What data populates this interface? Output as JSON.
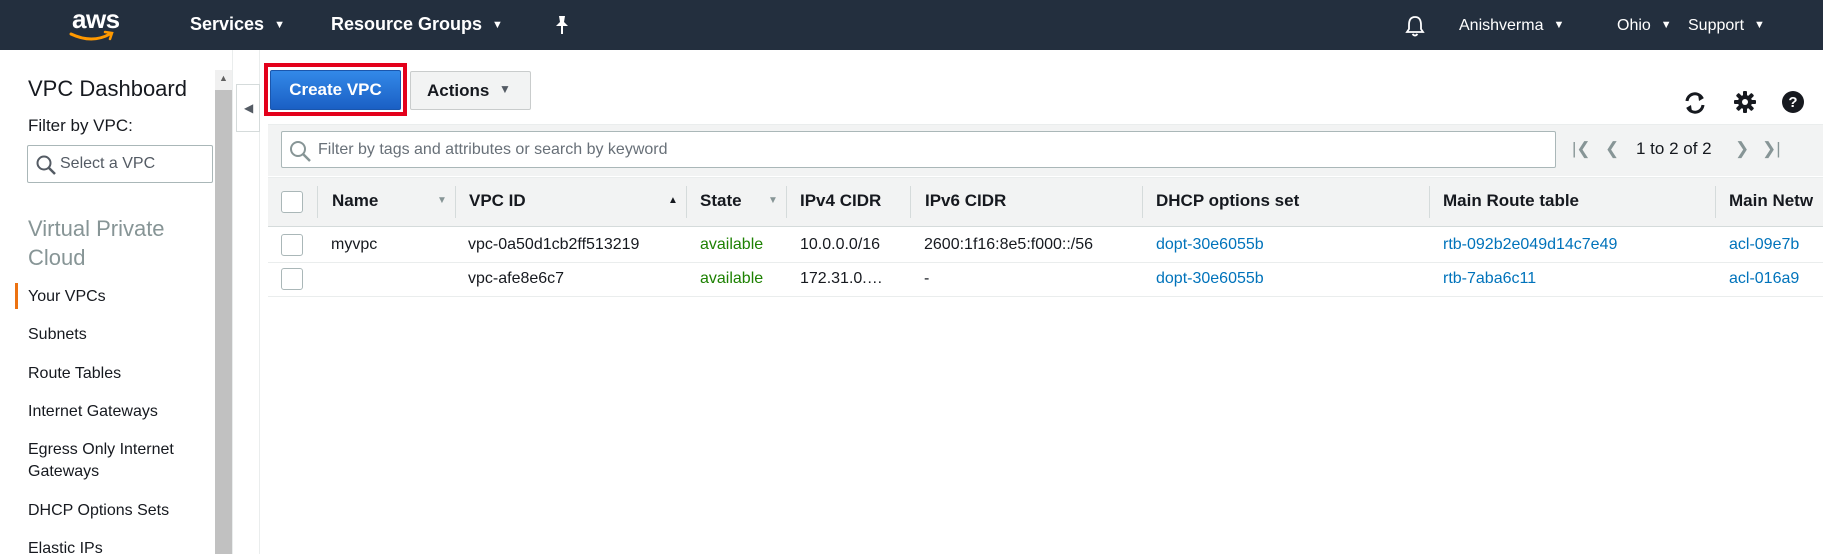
{
  "topnav": {
    "logo_text": "aws",
    "services": "Services",
    "resource_groups": "Resource Groups",
    "user": "Anishverma",
    "region": "Ohio",
    "support": "Support"
  },
  "sidebar": {
    "title": "VPC Dashboard",
    "filter_label": "Filter by VPC:",
    "select_placeholder": "Select a VPC",
    "section": "Virtual Private Cloud",
    "items": [
      {
        "label": "Your VPCs",
        "active": true
      },
      {
        "label": "Subnets"
      },
      {
        "label": "Route Tables"
      },
      {
        "label": "Internet Gateways"
      },
      {
        "label": "Egress Only Internet Gateways"
      },
      {
        "label": "DHCP Options Sets"
      },
      {
        "label": "Elastic IPs"
      }
    ]
  },
  "toolbar": {
    "create_label": "Create VPC",
    "actions_label": "Actions"
  },
  "filter": {
    "placeholder": "Filter by tags and attributes or search by keyword",
    "pager_text": "1 to 2 of 2"
  },
  "table": {
    "headers": [
      "Name",
      "VPC ID",
      "State",
      "IPv4 CIDR",
      "IPv6 CIDR",
      "DHCP options set",
      "Main Route table",
      "Main Netw"
    ],
    "rows": [
      {
        "name": "myvpc",
        "vpc_id": "vpc-0a50d1cb2ff513219",
        "state": "available",
        "ipv4": "10.0.0.0/16",
        "ipv6": "2600:1f16:8e5:f000::/56",
        "dhcp": "dopt-30e6055b",
        "route": "rtb-092b2e049d14c7e49",
        "acl": "acl-09e7b"
      },
      {
        "name": "",
        "vpc_id": "vpc-afe8e6c7",
        "state": "available",
        "ipv4": "172.31.0.…",
        "ipv6": "-",
        "dhcp": "dopt-30e6055b",
        "route": "rtb-7aba6c11",
        "acl": "acl-016a9"
      }
    ]
  },
  "colors": {
    "nav_bg": "#232f3e",
    "primary_button": "#1f6fd0",
    "highlight_outline": "#e3001b",
    "available": "#1d8102",
    "link": "#0073bb",
    "active_accent": "#ec7211"
  }
}
